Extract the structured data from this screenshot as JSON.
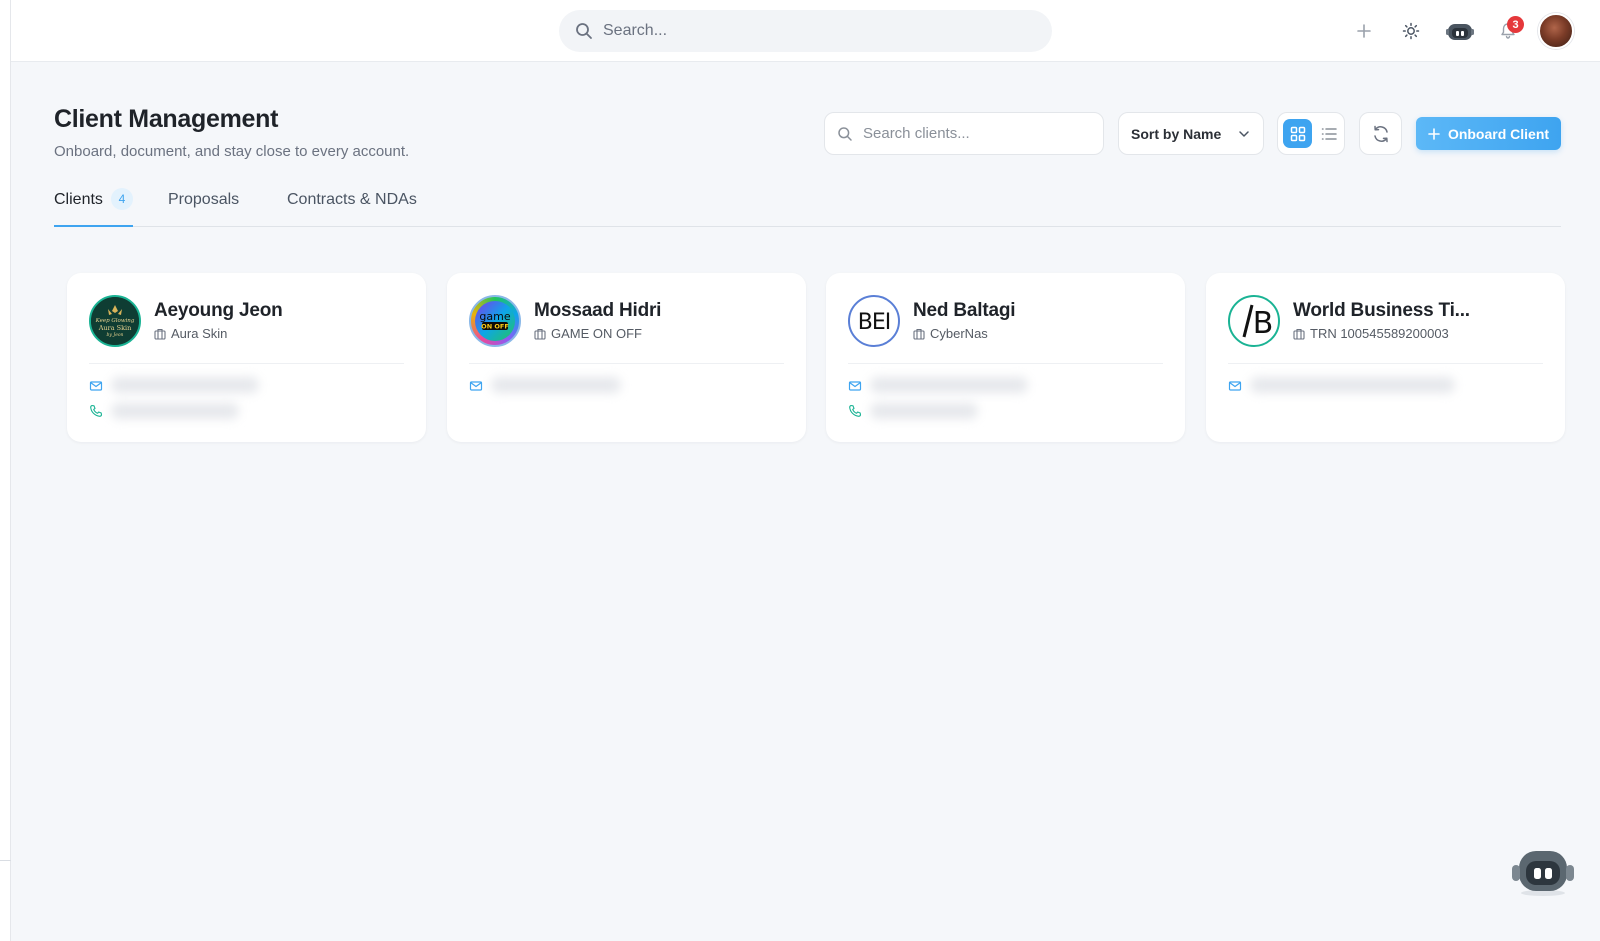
{
  "topbar": {
    "search_placeholder": "Search...",
    "notification_count": "3",
    "icons": [
      "search-icon",
      "plus-icon",
      "sun-icon",
      "robot-icon",
      "bell-icon"
    ]
  },
  "header": {
    "title": "Client Management",
    "subtitle": "Onboard, document, and stay close to every account.",
    "search_placeholder": "Search clients...",
    "sort_label": "Sort by Name",
    "onboard_label": "Onboard Client"
  },
  "tabs": [
    {
      "label": "Clients",
      "count": "4",
      "active": true
    },
    {
      "label": "Proposals",
      "active": false
    },
    {
      "label": "Contracts & NDAs",
      "active": false
    }
  ],
  "clients": [
    {
      "name": "Aeyoung Jeon",
      "company": "Aura Skin",
      "logo_text": "Keep Glowing Aura Skin by Jeon",
      "has_phone": true
    },
    {
      "name": "Mossaad Hidri",
      "company": "GAME ON OFF",
      "logo_text": "game ON OFF",
      "has_phone": false
    },
    {
      "name": "Ned Baltagi",
      "company": "CyberNas",
      "logo_text": "BEI",
      "has_phone": true
    },
    {
      "name": "World Business Ti...",
      "company": "TRN 100545589200003",
      "logo_text": "/B",
      "has_phone": false
    }
  ],
  "colors": {
    "accent": "#3ea4f0",
    "badge_red": "#e5383b",
    "background": "#f5f7fa"
  }
}
